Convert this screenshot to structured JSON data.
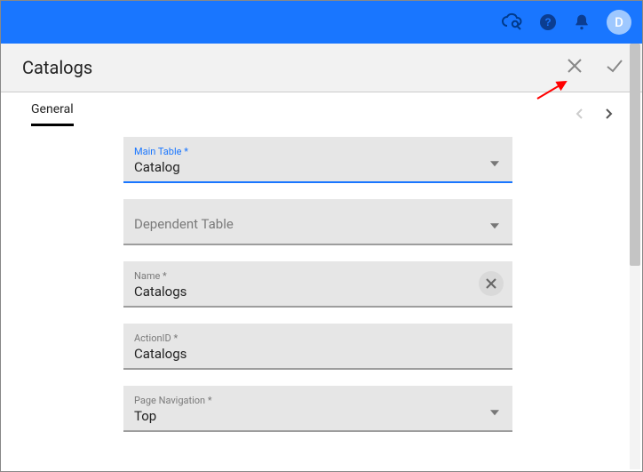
{
  "topbar": {
    "avatar_letter": "D"
  },
  "header": {
    "title": "Catalogs"
  },
  "tabs": {
    "general": "General"
  },
  "fields": {
    "main_table": {
      "label": "Main Table *",
      "value": "Catalog"
    },
    "dependent_table": {
      "label": "Dependent Table",
      "value": ""
    },
    "name": {
      "label": "Name *",
      "value": "Catalogs"
    },
    "action_id": {
      "label": "ActionID *",
      "value": "Catalogs"
    },
    "page_navigation": {
      "label": "Page Navigation *",
      "value": "Top"
    }
  }
}
